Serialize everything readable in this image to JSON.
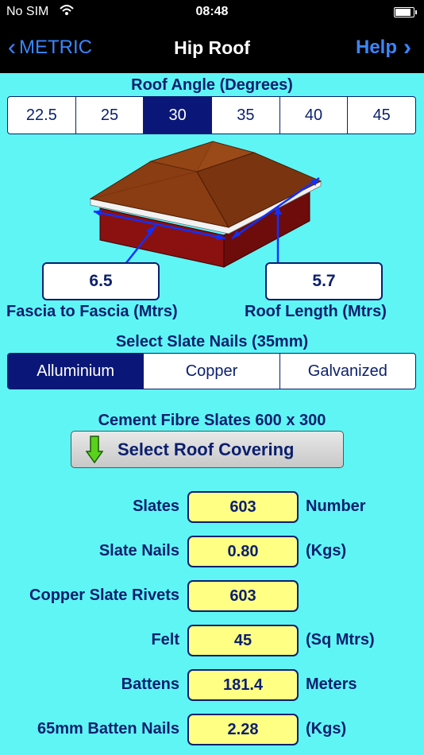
{
  "status_bar": {
    "carrier": "No SIM",
    "time": "08:48"
  },
  "nav": {
    "back_label": "METRIC",
    "title": "Hip Roof",
    "help_label": "Help"
  },
  "roof_angle": {
    "label": "Roof Angle (Degrees)",
    "options": [
      "22.5",
      "25",
      "30",
      "35",
      "40",
      "45"
    ],
    "selected": "30"
  },
  "dimensions": {
    "fascia_value": "6.5",
    "fascia_label": "Fascia to Fascia (Mtrs)",
    "length_value": "5.7",
    "length_label": "Roof Length (Mtrs)"
  },
  "nails": {
    "label": "Select Slate Nails (35mm)",
    "options": [
      "Alluminium",
      "Copper",
      "Galvanized"
    ],
    "selected": "Alluminium"
  },
  "covering": {
    "title": "Cement Fibre Slates 600 x 300",
    "button_label": "Select Roof Covering"
  },
  "results": [
    {
      "label": "Slates",
      "value": "603",
      "unit": "Number"
    },
    {
      "label": "Slate Nails",
      "value": "0.80",
      "unit": "(Kgs)"
    },
    {
      "label": "Copper Slate Rivets",
      "value": "603",
      "unit": ""
    },
    {
      "label": "Felt",
      "value": "45",
      "unit": "(Sq Mtrs)"
    },
    {
      "label": "Battens",
      "value": "181.4",
      "unit": "Meters"
    },
    {
      "label": "65mm Batten Nails",
      "value": "2.28",
      "unit": "(Kgs)"
    }
  ],
  "colors": {
    "background": "#5ff5f5",
    "accent": "#0a1778",
    "text": "#0b1f6e",
    "value_field": "#ffff84",
    "nav_link": "#3a86ff"
  }
}
